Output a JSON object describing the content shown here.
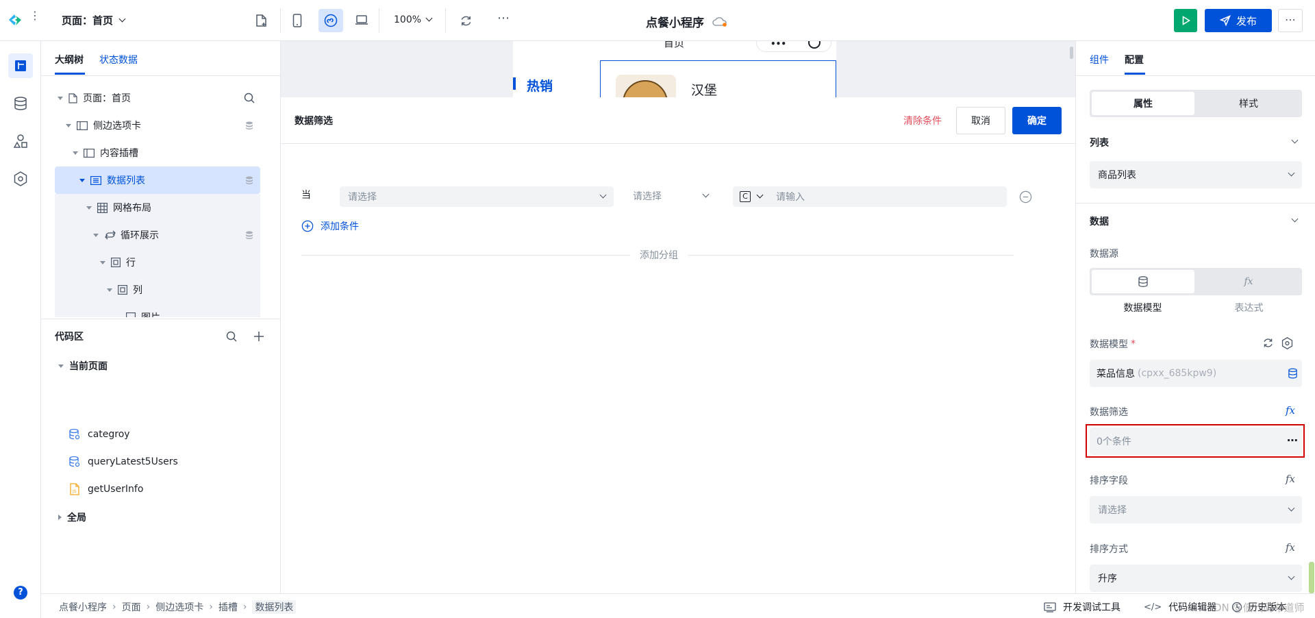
{
  "topbar": {
    "page_selector": "页面：首页",
    "zoom": "100%",
    "app_title": "点餐小程序",
    "publish_label": "发布",
    "more": "⋯"
  },
  "left_panel": {
    "tabs": [
      "大纲树",
      "状态数据"
    ],
    "tree": [
      {
        "label": "页面：首页"
      },
      {
        "label": "侧边选项卡"
      },
      {
        "label": "内容插槽"
      },
      {
        "label": "数据列表"
      },
      {
        "label": "网格布局"
      },
      {
        "label": "循环展示"
      },
      {
        "label": "行"
      },
      {
        "label": "列"
      },
      {
        "label": "图片"
      }
    ],
    "code_area": {
      "title": "代码区",
      "current_page": "当前页面",
      "items": [
        "categroy",
        "queryLatest5Users",
        "getUserInfo"
      ],
      "global": "全局"
    }
  },
  "canvas": {
    "preview": {
      "header": "首页",
      "category": "热销",
      "product": "汉堡"
    },
    "filter_dialog": {
      "title": "数据筛选",
      "clear_label": "清除条件",
      "cancel_label": "取消",
      "confirm_label": "确定",
      "when_label": "当",
      "field_placeholder": "请选择",
      "operator_placeholder": "请选择",
      "value_type_icon": "C",
      "value_placeholder": "请输入",
      "add_condition": "添加条件",
      "add_group": "添加分组"
    }
  },
  "right_panel": {
    "tabs": [
      "组件",
      "配置"
    ],
    "segment": [
      "属性",
      "样式"
    ],
    "list_section": {
      "title": "列表",
      "value": "商品列表"
    },
    "data_section": {
      "title": "数据",
      "source_label": "数据源",
      "source_options": [
        "数据模型",
        "表达式"
      ],
      "model_label": "数据模型",
      "required_mark": "*",
      "model_value": "菜品信息",
      "model_id": "(cpxx_685kpw9)",
      "filter_label": "数据筛选",
      "filter_value": "0个条件",
      "sort_field_label": "排序字段",
      "sort_field_placeholder": "请选择",
      "sort_order_label": "排序方式",
      "sort_order_value": "升序",
      "fx": "fx"
    }
  },
  "bottombar": {
    "breadcrumb": [
      "点餐小程序",
      "页面",
      "侧边选项卡",
      "插槽",
      "数据列表"
    ],
    "devtools": "开发调试工具",
    "code_editor": "代码编辑器",
    "history": "历史版本",
    "watermark": "CSDN @低代码布道师"
  },
  "colors": {
    "primary": "#0052d9",
    "run_green": "#00a870",
    "danger": "#e34d59",
    "highlight_box": "#d40000"
  }
}
